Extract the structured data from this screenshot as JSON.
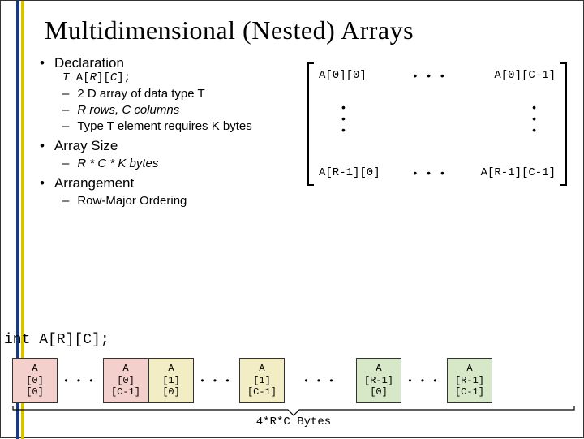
{
  "title": "Multidimensional (Nested) Arrays",
  "bullets": {
    "declaration": "Declaration",
    "decl_code": {
      "T": "T",
      "mid": " A[",
      "R": "R",
      "mid2": "][",
      "C": "C",
      "end": "];"
    },
    "decl_subs": [
      "2 D array of data type T",
      "R rows, C columns",
      "Type T element requires K bytes"
    ],
    "array_size": "Array Size",
    "size_sub": "R * C * K bytes",
    "arrangement": "Arrangement",
    "arr_sub": "Row-Major Ordering"
  },
  "matrix": {
    "tl": "A[0][0]",
    "tr": "A[0][C-1]",
    "bl": "A[R-1][0]",
    "br": "A[R-1][C-1]",
    "dots": "•  •  •"
  },
  "layout_decl": "int A[R][C];",
  "cells": {
    "a00": [
      "A",
      "[0]",
      "[0]"
    ],
    "a0c": [
      "A",
      "[0]",
      "[C-1]"
    ],
    "a10": [
      "A",
      "[1]",
      "[0]"
    ],
    "a1c": [
      "A",
      "[1]",
      "[C-1]"
    ],
    "ar0": [
      "A",
      "[R-1]",
      "[0]"
    ],
    "arc": [
      "A",
      "[R-1]",
      "[C-1]"
    ],
    "dots": "•  •  •"
  },
  "brace_label": "4*R*C Bytes"
}
